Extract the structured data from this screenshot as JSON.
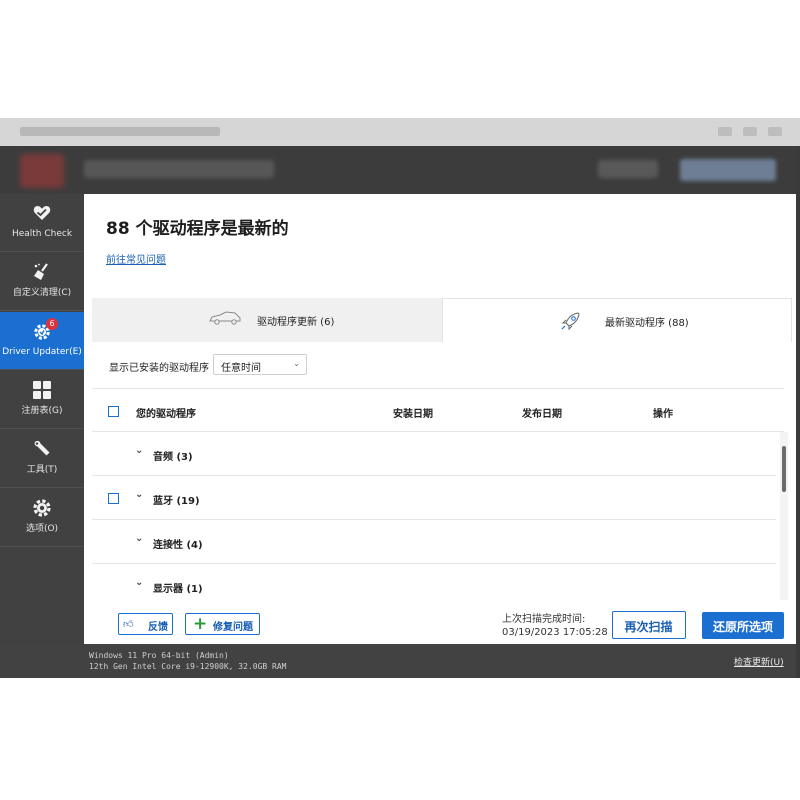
{
  "sidebar": {
    "items": [
      {
        "label": "Health Check",
        "icon": "heart-icon"
      },
      {
        "label": "自定义清理(C)",
        "icon": "broom-icon"
      },
      {
        "label": "Driver Updater(E)",
        "icon": "driver-gear-icon",
        "badge": "6",
        "active": true
      },
      {
        "label": "注册表(G)",
        "icon": "grid-icon"
      },
      {
        "label": "工具(T)",
        "icon": "wrench-icon"
      },
      {
        "label": "选项(O)",
        "icon": "settings-gear-icon"
      }
    ]
  },
  "main": {
    "title": "88 个驱动程序是最新的",
    "faq_link": "前往常见问题",
    "tabs": [
      {
        "label": "驱动程序更新 (6)",
        "icon": "car-icon"
      },
      {
        "label": "最新驱动程序 (88)",
        "icon": "rocket-icon",
        "active": true
      }
    ],
    "filter": {
      "label": "显示已安装的驱动程序",
      "value": "任意时间"
    },
    "table": {
      "columns": [
        "您的驱动程序",
        "安装日期",
        "发布日期",
        "操作"
      ],
      "rows": [
        {
          "label": "音频 (3)",
          "checkbox": false
        },
        {
          "label": "蓝牙 (19)",
          "checkbox": true
        },
        {
          "label": "连接性 (4)",
          "checkbox": false
        },
        {
          "label": "显示器 (1)",
          "checkbox": false
        }
      ]
    },
    "footer": {
      "feedback": "反馈",
      "fix": "修复问题",
      "scan_label": "上次扫描完成时间:",
      "scan_time": "03/19/2023 17:05:28",
      "rescan": "再次扫描",
      "restore_all": "还原所选项"
    }
  },
  "statusbar": {
    "os": "Windows 11 Pro 64-bit (Admin)",
    "hardware": "12th Gen Intel Core i9-12900K, 32.0GB RAM",
    "check_updates": "检查更新(U)"
  },
  "colors": {
    "accent": "#1a6fd1",
    "sidebar_bg": "#414141",
    "badge": "#e0313a",
    "fix_plus": "#2a9a34"
  }
}
